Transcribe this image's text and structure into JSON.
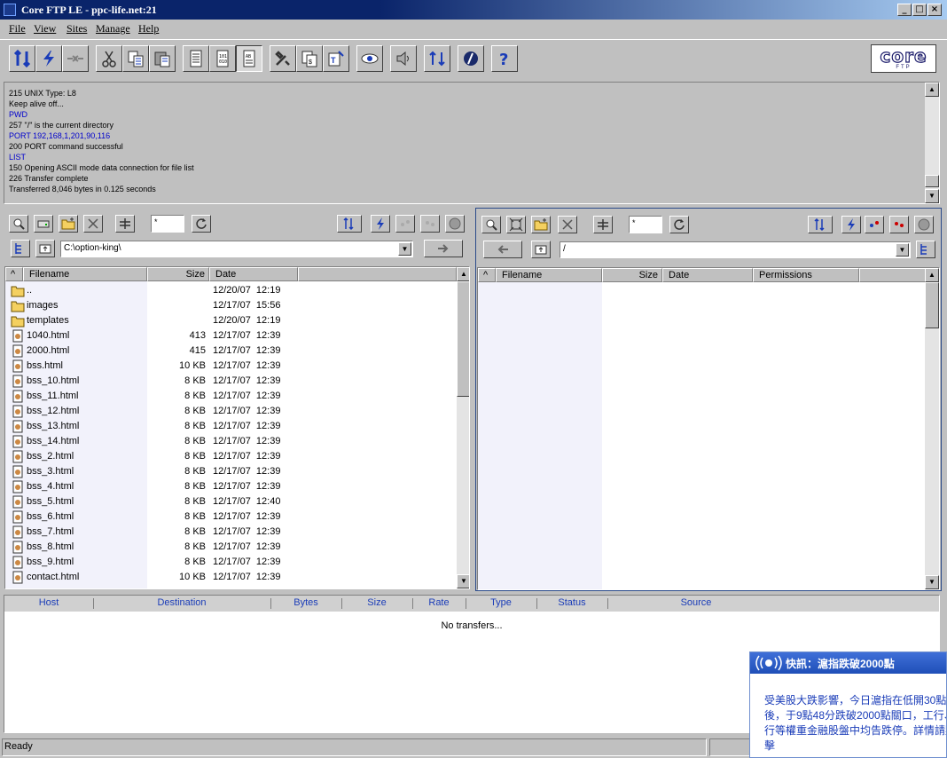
{
  "window": {
    "title": "Core FTP LE - ppc-life.net:21"
  },
  "menu": [
    "File",
    "View",
    "Sites",
    "Manage",
    "Help"
  ],
  "logo": {
    "text": "core",
    "subtext": "FTP"
  },
  "log": [
    {
      "text": "215 UNIX Type: L8",
      "kind": "resp"
    },
    {
      "text": "Keep alive off...",
      "kind": "resp"
    },
    {
      "text": "PWD",
      "kind": "cmd"
    },
    {
      "text": "257 \"/\" is the current directory",
      "kind": "resp"
    },
    {
      "text": "PORT 192,168,1,201,90,116",
      "kind": "cmd"
    },
    {
      "text": "200 PORT command successful",
      "kind": "resp"
    },
    {
      "text": "LIST",
      "kind": "cmd"
    },
    {
      "text": "150 Opening ASCII mode data connection for file list",
      "kind": "resp"
    },
    {
      "text": "226 Transfer complete",
      "kind": "resp"
    },
    {
      "text": "Transferred 8,046 bytes in 0.125 seconds",
      "kind": "resp"
    }
  ],
  "local": {
    "filter": "*",
    "path": "C:\\option-king\\",
    "columns": {
      "sort": "^",
      "name": "Filename",
      "size": "Size",
      "date": "Date"
    },
    "files": [
      {
        "name": "..",
        "size": "",
        "date": "12/20/07  12:19",
        "type": "folder"
      },
      {
        "name": "images",
        "size": "",
        "date": "12/17/07  15:56",
        "type": "folder"
      },
      {
        "name": "templates",
        "size": "",
        "date": "12/20/07  12:19",
        "type": "folder"
      },
      {
        "name": "1040.html",
        "size": "413",
        "date": "12/17/07  12:39",
        "type": "file"
      },
      {
        "name": "2000.html",
        "size": "415",
        "date": "12/17/07  12:39",
        "type": "file"
      },
      {
        "name": "bss.html",
        "size": "10 KB",
        "date": "12/17/07  12:39",
        "type": "file"
      },
      {
        "name": "bss_10.html",
        "size": "8 KB",
        "date": "12/17/07  12:39",
        "type": "file"
      },
      {
        "name": "bss_11.html",
        "size": "8 KB",
        "date": "12/17/07  12:39",
        "type": "file"
      },
      {
        "name": "bss_12.html",
        "size": "8 KB",
        "date": "12/17/07  12:39",
        "type": "file"
      },
      {
        "name": "bss_13.html",
        "size": "8 KB",
        "date": "12/17/07  12:39",
        "type": "file"
      },
      {
        "name": "bss_14.html",
        "size": "8 KB",
        "date": "12/17/07  12:39",
        "type": "file"
      },
      {
        "name": "bss_2.html",
        "size": "8 KB",
        "date": "12/17/07  12:39",
        "type": "file"
      },
      {
        "name": "bss_3.html",
        "size": "8 KB",
        "date": "12/17/07  12:39",
        "type": "file"
      },
      {
        "name": "bss_4.html",
        "size": "8 KB",
        "date": "12/17/07  12:39",
        "type": "file"
      },
      {
        "name": "bss_5.html",
        "size": "8 KB",
        "date": "12/17/07  12:40",
        "type": "file"
      },
      {
        "name": "bss_6.html",
        "size": "8 KB",
        "date": "12/17/07  12:39",
        "type": "file"
      },
      {
        "name": "bss_7.html",
        "size": "8 KB",
        "date": "12/17/07  12:39",
        "type": "file"
      },
      {
        "name": "bss_8.html",
        "size": "8 KB",
        "date": "12/17/07  12:39",
        "type": "file"
      },
      {
        "name": "bss_9.html",
        "size": "8 KB",
        "date": "12/17/07  12:39",
        "type": "file"
      },
      {
        "name": "contact.html",
        "size": "10 KB",
        "date": "12/17/07  12:39",
        "type": "file"
      }
    ]
  },
  "remote": {
    "filter": "*",
    "path": "/",
    "columns": {
      "sort": "^",
      "name": "Filename",
      "size": "Size",
      "date": "Date",
      "perms": "Permissions"
    }
  },
  "transfers": {
    "columns": [
      "Host",
      "Destination",
      "Bytes",
      "Size",
      "Rate",
      "Type",
      "Status",
      "Source"
    ],
    "empty": "No transfers..."
  },
  "status": {
    "text": "Ready"
  },
  "popup": {
    "title": "快訊：滬指跌破2000點",
    "body": [
      "受美股大跌影響，今日滬指在低開30點之",
      "後，于9點48分跌破2000點關口，工行、中",
      "行等權重金融股盤中均告跌停。詳情請點",
      "擊"
    ]
  },
  "colors": {
    "accent": "#0a246a",
    "command": "#0000cc",
    "transfer_header": "#1a3cb8"
  }
}
